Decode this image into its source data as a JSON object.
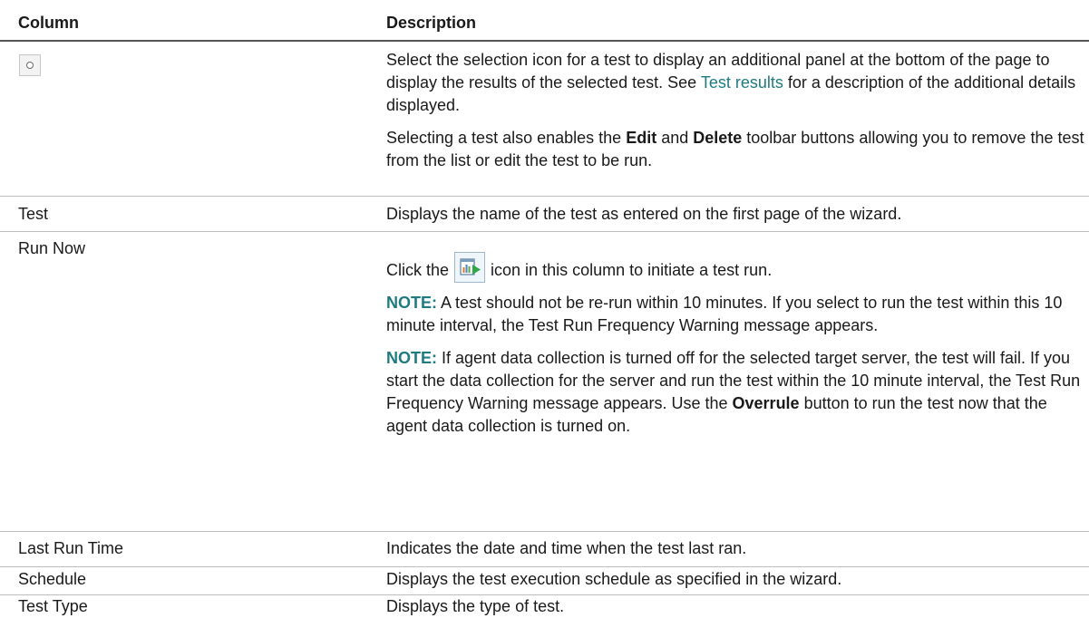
{
  "headers": {
    "column": "Column",
    "description": "Description"
  },
  "rows": {
    "selection": {
      "p1_before": "Select the selection icon for a test to display an additional panel at the bottom of the page to display the results of the selected test. See ",
      "link": "Test results",
      "p1_after": " for a description of the additional details displayed.",
      "p2_a": "Selecting a test also enables the ",
      "edit": "Edit",
      "p2_and": " and ",
      "delete": "Delete",
      "p2_b": " toolbar buttons allowing you to remove the test from the list or edit the test to be run."
    },
    "test": {
      "label": "Test",
      "desc": "Displays the name of the test as entered on the first page of the wizard."
    },
    "run_now": {
      "label": "Run Now",
      "click_before": "Click the",
      "click_after": "icon in this column to initiate a test run.",
      "note_label": "NOTE:",
      "note1": " A test should not be re-run within 10 minutes. If you select to run the test within this 10 minute interval, the Test Run Frequency Warning message appears.",
      "note2_a": " If agent data collection is turned off for the selected target server, the test will fail. If you start the data collection for the server and run the test within the 10 minute interval, the Test Run Frequency Warning message appears. Use the ",
      "overrule": "Overrule",
      "note2_b": " button to run the test now that the agent data collection is turned on."
    },
    "last_run": {
      "label": "Last Run Time",
      "desc": "Indicates the date and time when the test last ran."
    },
    "schedule": {
      "label": "Schedule",
      "desc": "Displays the test execution schedule as specified in the wizard."
    },
    "test_type": {
      "label": "Test Type",
      "desc": "Displays the type of test."
    }
  }
}
